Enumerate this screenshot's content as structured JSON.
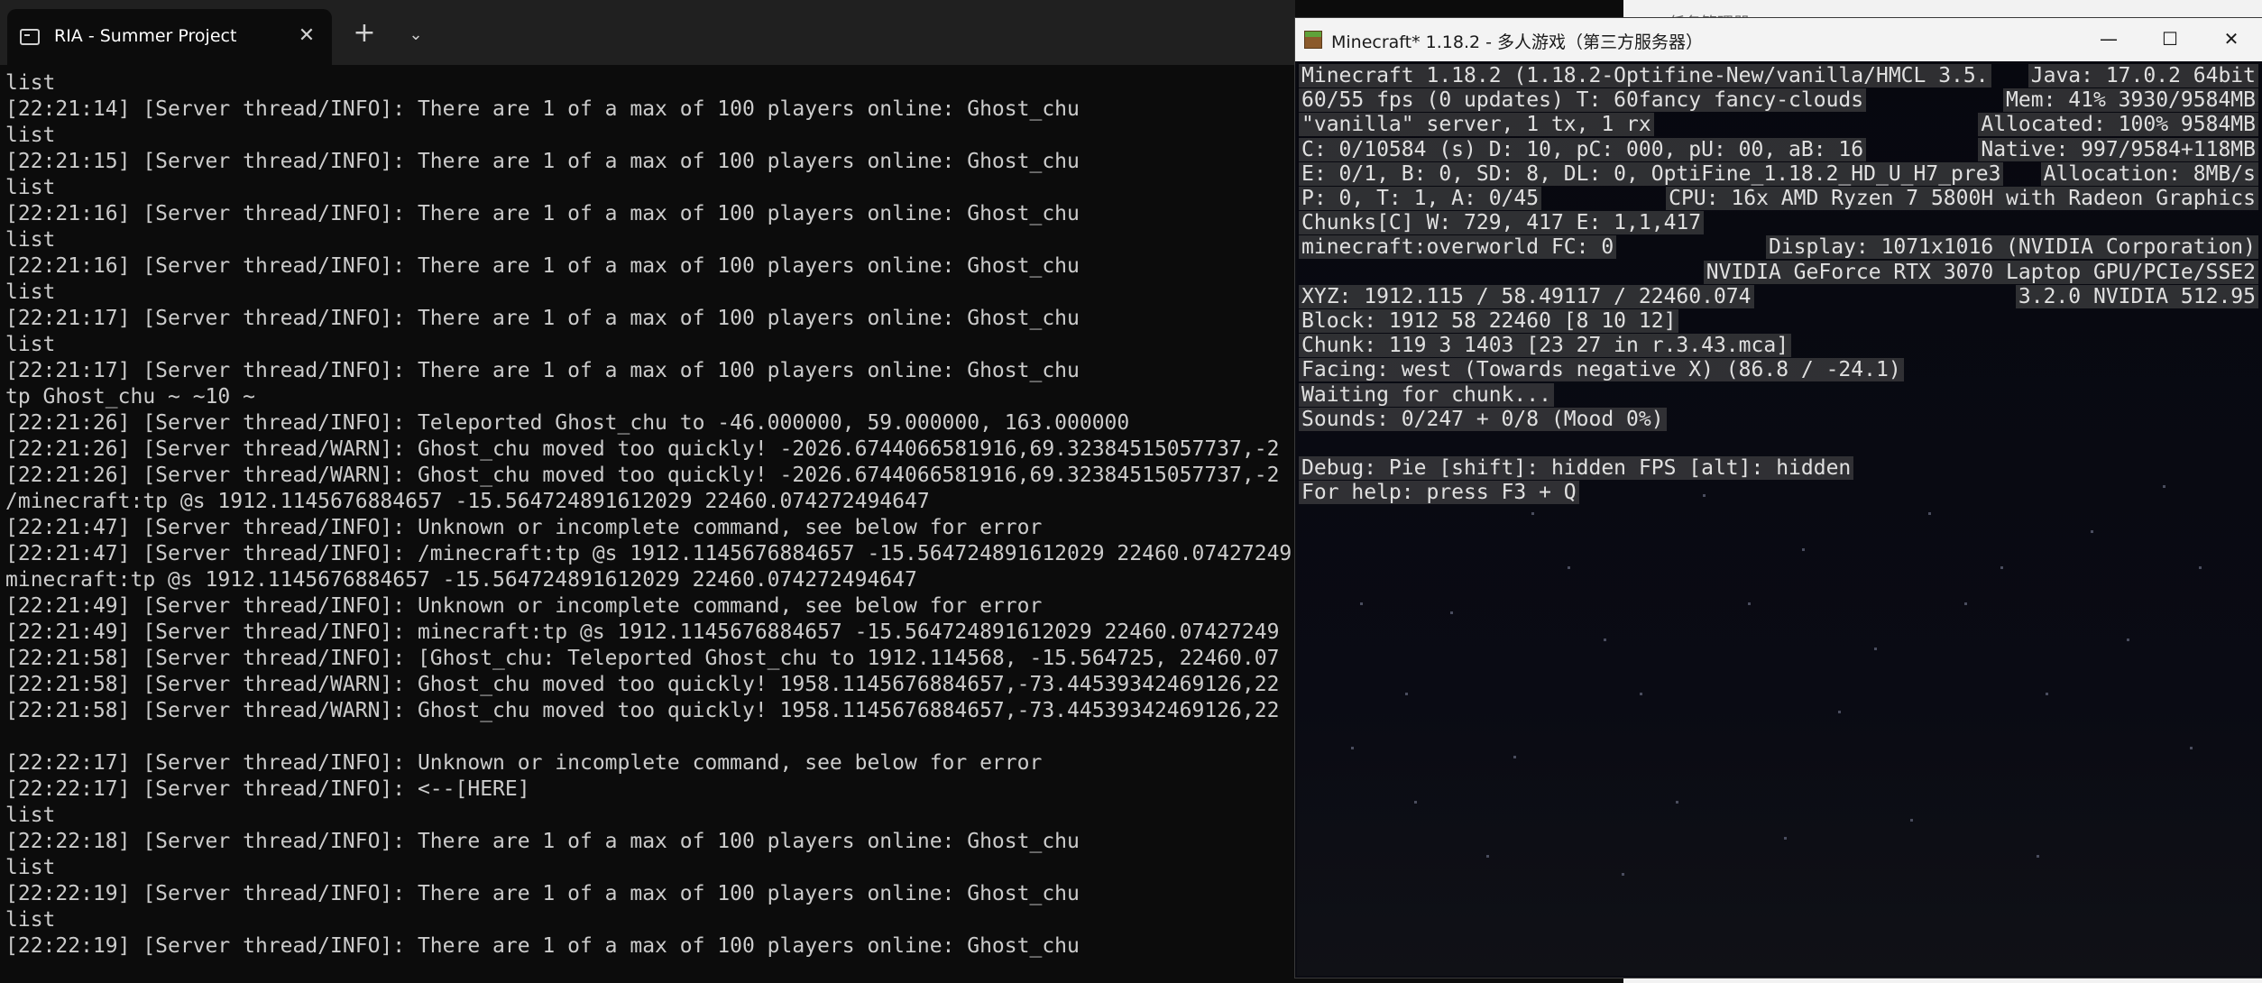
{
  "terminal": {
    "tab_title": "RIA - Summer Project",
    "tab_close": "✕",
    "new_tab": "+",
    "dropdown": "⌄",
    "lines": [
      "list",
      "[22:21:14] [Server thread/INFO]: There are 1 of a max of 100 players online: Ghost_chu",
      "list",
      "[22:21:15] [Server thread/INFO]: There are 1 of a max of 100 players online: Ghost_chu",
      "list",
      "[22:21:16] [Server thread/INFO]: There are 1 of a max of 100 players online: Ghost_chu",
      "list",
      "[22:21:16] [Server thread/INFO]: There are 1 of a max of 100 players online: Ghost_chu",
      "list",
      "[22:21:17] [Server thread/INFO]: There are 1 of a max of 100 players online: Ghost_chu",
      "list",
      "[22:21:17] [Server thread/INFO]: There are 1 of a max of 100 players online: Ghost_chu",
      "tp Ghost_chu ~ ~10 ~",
      "[22:21:26] [Server thread/INFO]: Teleported Ghost_chu to -46.000000, 59.000000, 163.000000",
      "[22:21:26] [Server thread/WARN]: Ghost_chu moved too quickly! -2026.6744066581916,69.32384515057737,-2",
      "[22:21:26] [Server thread/WARN]: Ghost_chu moved too quickly! -2026.6744066581916,69.32384515057737,-2",
      "/minecraft:tp @s 1912.1145676884657 -15.564724891612029 22460.074272494647",
      "[22:21:47] [Server thread/INFO]: Unknown or incomplete command, see below for error",
      "[22:21:47] [Server thread/INFO]: /minecraft:tp @s 1912.1145676884657 -15.564724891612029 22460.07427249",
      "minecraft:tp @s 1912.1145676884657 -15.564724891612029 22460.074272494647",
      "[22:21:49] [Server thread/INFO]: Unknown or incomplete command, see below for error",
      "[22:21:49] [Server thread/INFO]: minecraft:tp @s 1912.1145676884657 -15.564724891612029 22460.07427249",
      "[22:21:58] [Server thread/INFO]: [Ghost_chu: Teleported Ghost_chu to 1912.114568, -15.564725, 22460.07",
      "[22:21:58] [Server thread/WARN]: Ghost_chu moved too quickly! 1958.1145676884657,-73.44539342469126,22",
      "[22:21:58] [Server thread/WARN]: Ghost_chu moved too quickly! 1958.1145676884657,-73.44539342469126,22",
      "",
      "[22:22:17] [Server thread/INFO]: Unknown or incomplete command, see below for error",
      "[22:22:17] [Server thread/INFO]: <--[HERE]",
      "list",
      "[22:22:18] [Server thread/INFO]: There are 1 of a max of 100 players online: Ghost_chu",
      "list",
      "[22:22:19] [Server thread/INFO]: There are 1 of a max of 100 players online: Ghost_chu",
      "list",
      "[22:22:19] [Server thread/INFO]: There are 1 of a max of 100 players online: Ghost_chu"
    ]
  },
  "background_window": {
    "title": "任务管理器"
  },
  "minecraft": {
    "title": "Minecraft* 1.18.2 - 多人游戏（第三方服务器）",
    "controls": {
      "minimize": "—",
      "maximize": "☐",
      "close": "✕"
    },
    "debug_left": [
      "Minecraft 1.18.2 (1.18.2-Optifine-New/vanilla/HMCL 3.5.",
      "60/55 fps (0 updates) T: 60fancy fancy-clouds",
      "\"vanilla\" server, 1 tx, 1 rx",
      "C: 0/10584 (s) D: 10, pC: 000, pU: 00, aB: 16",
      "E: 0/1, B: 0, SD: 8, DL: 0, OptiFine_1.18.2_HD_U_H7_pre3",
      "P: 0, T: 1, A: 0/45",
      "Chunks[C] W: 729, 417 E: 1,1,417",
      "minecraft:overworld FC: 0",
      "XYZ: 1912.115 / 58.49117 / 22460.074",
      "Block: 1912 58 22460 [8 10 12]",
      "Chunk: 119 3 1403 [23 27 in r.3.43.mca]",
      "Facing: west (Towards negative X) (86.8 / -24.1)",
      "Waiting for chunk...",
      "Sounds: 0/247 + 0/8 (Mood 0%)",
      "Debug: Pie [shift]: hidden FPS [alt]: hidden",
      "For help: press F3 + Q"
    ],
    "debug_right": [
      "Java: 17.0.2 64bit",
      "Mem: 41% 3930/9584MB",
      "Allocated: 100% 9584MB",
      "Native: 997/9584+118MB",
      "Allocation: 8MB/s",
      "CPU: 16x AMD Ryzen 7 5800H with Radeon Graphics",
      "Display: 1071x1016 (NVIDIA Corporation)",
      "NVIDIA GeForce RTX 3070 Laptop GPU/PCIe/SSE2",
      "3.2.0 NVIDIA 512.95"
    ]
  }
}
